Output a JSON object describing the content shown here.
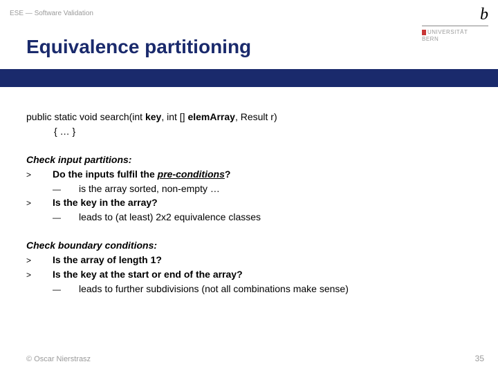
{
  "header": {
    "course": "ESE — Software Validation"
  },
  "logo": {
    "b_html": "b",
    "uni_line1": "UNIVERSITÄT",
    "uni_line2": "BERN"
  },
  "title": "Equivalence partitioning",
  "code": {
    "line1_pre": "public static void search(int ",
    "line1_key": "key",
    "line1_mid": ", int [] ",
    "line1_arr": "elemArray",
    "line1_post": ", Result r)",
    "line2": "{ … }"
  },
  "section1": {
    "heading": "Check input partitions:",
    "b1_pre": "Do the inputs fulfil the ",
    "b1_em": "pre-conditions",
    "b1_post": "?",
    "d1": "is the array sorted, non-empty …",
    "b2": "Is the key in the array?",
    "d2": "leads to (at least) 2x2 equivalence classes"
  },
  "section2": {
    "heading": "Check boundary conditions:",
    "b1": "Is the array of length 1?",
    "b2": "Is the key at the start or end of the array?",
    "d1": "leads to further subdivisions (not all combinations make sense)"
  },
  "footer": {
    "copyright": "© Oscar Nierstrasz",
    "page": "35"
  },
  "markers": {
    "angle": ">",
    "dash": "—"
  }
}
